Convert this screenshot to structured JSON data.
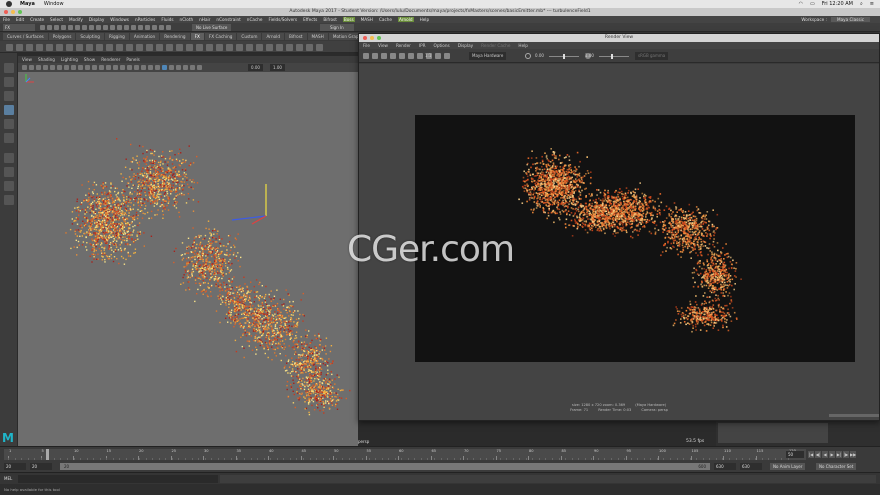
{
  "macos": {
    "app": "Maya",
    "menu": [
      "Window"
    ],
    "clock": "Fri 12:20 AM"
  },
  "maya": {
    "window_title": "Autodesk Maya 2017 - Student Version: /Users/lulu/Documents/maya/projects/fxMasters/scenes/basicEmitter.mb* --- turbulenceField1",
    "menu": [
      "File",
      "Edit",
      "Create",
      "Select",
      "Modify",
      "Display",
      "Windows",
      "nParticles",
      "Fluids",
      "nCloth",
      "nHair",
      "nConstraint",
      "nCache",
      "Fields/Solvers",
      "Effects",
      "Bifrost",
      "Boss",
      "MASH",
      "Cache",
      "Arnold",
      "Help"
    ],
    "highlighted_menu": [
      "Boss",
      "Arnold"
    ],
    "workspace_label": "Workspace :",
    "workspace_value": "Maya Classic",
    "status_mode": "FX",
    "live_surface": "No Live Surface",
    "sign_in": "Sign In",
    "shelf_tabs": [
      "Curves / Surfaces",
      "Polygons",
      "Sculpting",
      "Rigging",
      "Animation",
      "Rendering",
      "FX",
      "FX Caching",
      "Custom",
      "Arnold",
      "Bifrost",
      "MASH",
      "Motion Graphics",
      "XGen"
    ],
    "active_shelf_tab": "FX"
  },
  "viewport": {
    "menu": [
      "View",
      "Shading",
      "Lighting",
      "Show",
      "Renderer",
      "Panels"
    ],
    "field_a": "0.00",
    "field_b": "1.00",
    "camera_label": "persp",
    "fps": "53.5 fps"
  },
  "render_view": {
    "title": "Render View",
    "menu": [
      "File",
      "View",
      "Render",
      "IPR",
      "Options",
      "Display",
      "Render Cache",
      "Help"
    ],
    "dim_menu": [
      "Render Cache"
    ],
    "ratio": "1:1",
    "renderer": "Maya Hardware",
    "exposure": "0.00",
    "gamma": "1.00",
    "color_space": "sRGB gamma",
    "info_line1": "size: 1280 x 720  zoom: 0.369",
    "info_renderer": "(Maya Hardware)",
    "info_frame": "Frame: 71",
    "info_time": "Render Time: 0:03",
    "info_camera": "Camera: persp"
  },
  "watermark": "CGer.com",
  "timeline": {
    "ticks_labels": [
      "1",
      "5",
      "10",
      "15",
      "20",
      "25",
      "30",
      "35",
      "40",
      "45",
      "50",
      "55",
      "60",
      "65",
      "70",
      "75",
      "80",
      "85",
      "90",
      "95",
      "100",
      "105",
      "110",
      "115",
      "120"
    ],
    "current_frame": "50",
    "playback_icons": [
      "|◀",
      "◀|",
      "◀",
      "▶",
      "▶|",
      "|▶",
      "▶▶"
    ]
  },
  "range": {
    "start": "20",
    "playback_start": "20",
    "bar_left": "20",
    "bar_right": "600",
    "playback_end": "630",
    "end": "630",
    "anim_layer": "No Anim Layer",
    "char_set": "No Character Set"
  },
  "command": {
    "language": "MEL",
    "help": "No help available for this tool"
  },
  "colors": {
    "accent": "#5a7fa0",
    "hl_menu": "#6a8d3a",
    "logo": "#1fb5c9"
  }
}
